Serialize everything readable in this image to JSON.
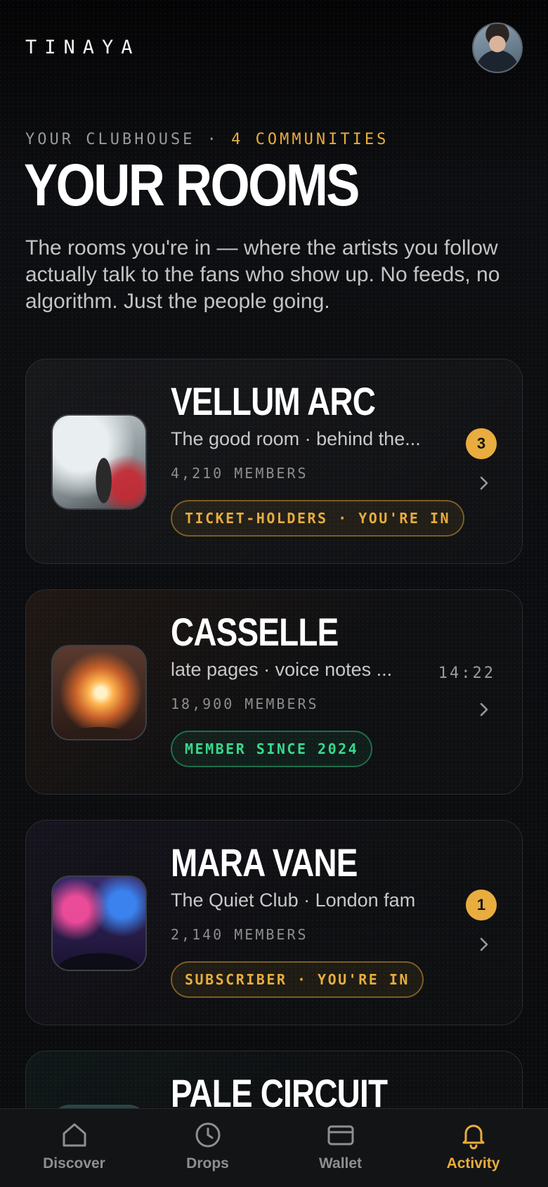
{
  "app": {
    "brand": "TINAYA"
  },
  "header": {
    "kicker": "YOUR CLUBHOUSE ·",
    "kicker_count": "4 COMMUNITIES",
    "title": "YOUR ROOMS",
    "intro": "The rooms you're in — where the artists you follow actually talk to the fans who show up. No feeds, no algorithm. Just the people going."
  },
  "rooms": [
    {
      "name": "VELLUM ARC",
      "subtitle": "The good room · behind the...",
      "members": "4,210 MEMBERS",
      "tag": "TICKET-HOLDERS · YOU'RE IN",
      "tag_style": "gold",
      "unread": "3"
    },
    {
      "name": "CASSELLE",
      "subtitle": "late pages · voice notes ...",
      "members": "18,900 MEMBERS",
      "tag": "MEMBER SINCE 2024",
      "tag_style": "green",
      "time": "14:22"
    },
    {
      "name": "MARA VANE",
      "subtitle": "The Quiet Club · London fam",
      "members": "2,140 MEMBERS",
      "tag": "SUBSCRIBER · YOU'RE IN",
      "tag_style": "gold",
      "unread": "1"
    },
    {
      "name": "PALE CIRCUIT"
    }
  ],
  "nav": [
    {
      "label": "Discover",
      "icon": "home-icon"
    },
    {
      "label": "Drops",
      "icon": "clock-icon"
    },
    {
      "label": "Wallet",
      "icon": "card-icon"
    },
    {
      "label": "Activity",
      "icon": "bell-icon",
      "active": true
    }
  ],
  "colors": {
    "accent": "#e8ad3e",
    "green": "#38d98c",
    "background": "#0b0b0d"
  }
}
